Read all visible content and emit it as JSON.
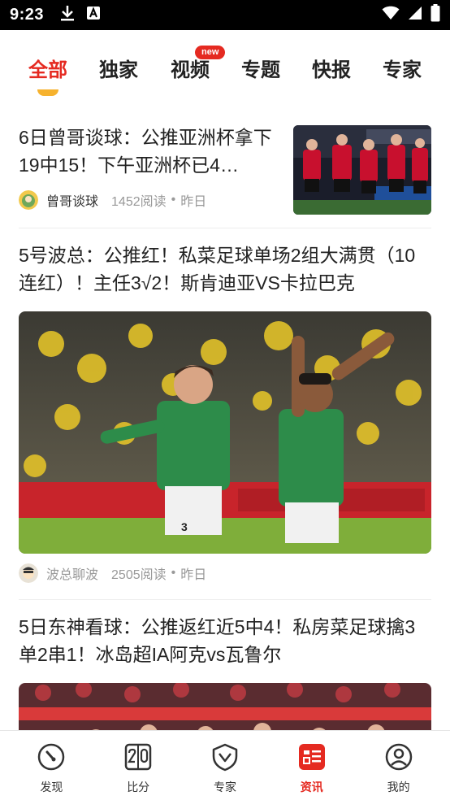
{
  "status_bar": {
    "time": "9:23"
  },
  "tabs": [
    {
      "label": "全部"
    },
    {
      "label": "独家"
    },
    {
      "label": "视频",
      "badge": "new"
    },
    {
      "label": "专题"
    },
    {
      "label": "快报"
    },
    {
      "label": "专家"
    }
  ],
  "articles": [
    {
      "title": "6日曾哥谈球：公推亚洲杯拿下19中15！下午亚洲杯已4…",
      "author": "曾哥谈球",
      "reads": "1452阅读",
      "time": "昨日"
    },
    {
      "title": "5号波总：公推红！私菜足球单场2组大满贯（10连红）！主任3√2！斯肯迪亚VS卡拉巴克",
      "author": "波总聊波",
      "reads": "2505阅读",
      "time": "昨日"
    },
    {
      "title": "5日东神看球：公推返红近5中4！私房菜足球擒3单2串1！冰岛超IA阿克vs瓦鲁尔"
    }
  ],
  "meta_separator": "•",
  "bottom_nav": [
    {
      "label": "发现",
      "icon": "compass-icon"
    },
    {
      "label": "比分",
      "icon": "scoreboard-icon"
    },
    {
      "label": "专家",
      "icon": "expert-shield-icon"
    },
    {
      "label": "资讯",
      "icon": "news-icon",
      "active": true
    },
    {
      "label": "我的",
      "icon": "profile-icon"
    }
  ],
  "colors": {
    "accent": "#e52a21",
    "underline": "#f6b22e"
  }
}
